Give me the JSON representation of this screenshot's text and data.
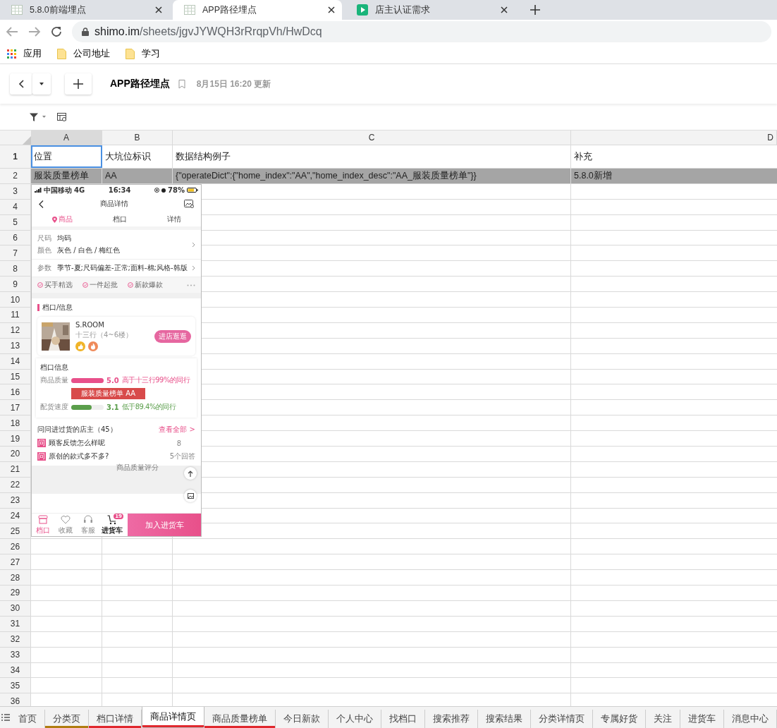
{
  "browser": {
    "tabs": [
      {
        "title": "5.8.0前端埋点",
        "selected": false,
        "kind": "sheet"
      },
      {
        "title": "APP路径埋点",
        "selected": true,
        "kind": "sheet"
      },
      {
        "title": "店主认证需求",
        "selected": false,
        "kind": "play"
      }
    ],
    "address": {
      "host": "shimo.im",
      "path": "/sheets/jgvJYWQH3rRrqpVh/HwDcq"
    },
    "bookmarks": [
      {
        "label": "应用",
        "kind": "apps"
      },
      {
        "label": "公司地址",
        "kind": "folder"
      },
      {
        "label": "学习",
        "kind": "folder"
      }
    ]
  },
  "document": {
    "title": "APP路径埋点",
    "updated": "8月15日 16:20 更新"
  },
  "sheet": {
    "columns": [
      {
        "label": "A",
        "selected": true
      },
      {
        "label": "B",
        "selected": false
      },
      {
        "label": "C",
        "selected": false
      },
      {
        "label": "D",
        "selected": false
      }
    ],
    "rows": [
      {
        "number": "1",
        "highlighted": false,
        "cells": [
          {
            "text": "位置",
            "active": true
          },
          {
            "text": "大坑位标识",
            "active": false
          },
          {
            "text": "数据结构例子",
            "active": false
          },
          {
            "text": "补充",
            "active": false
          }
        ]
      },
      {
        "number": "2",
        "highlighted": true,
        "cells": [
          {
            "text": "服装质量榜单",
            "active": false
          },
          {
            "text": "AA",
            "active": false
          },
          {
            "text": "{\"operateDict\":{\"home_index\":\"AA\",\"home_index_desc\":\"AA_服装质量榜单\"}}",
            "active": false
          },
          {
            "text": "5.8.0新增",
            "active": false
          }
        ]
      },
      {
        "number": "3",
        "highlighted": false
      },
      {
        "number": "4",
        "highlighted": false
      },
      {
        "number": "5",
        "highlighted": false
      },
      {
        "number": "6",
        "highlighted": false
      },
      {
        "number": "7",
        "highlighted": false
      },
      {
        "number": "8",
        "highlighted": false
      },
      {
        "number": "9",
        "highlighted": false
      },
      {
        "number": "10",
        "highlighted": false
      },
      {
        "number": "11",
        "highlighted": false
      },
      {
        "number": "12",
        "highlighted": false
      },
      {
        "number": "13",
        "highlighted": false
      },
      {
        "number": "14",
        "highlighted": false
      },
      {
        "number": "15",
        "highlighted": false
      },
      {
        "number": "16",
        "highlighted": false
      },
      {
        "number": "17",
        "highlighted": false
      },
      {
        "number": "18",
        "highlighted": false
      },
      {
        "number": "19",
        "highlighted": false
      },
      {
        "number": "20",
        "highlighted": false
      },
      {
        "number": "21",
        "highlighted": false
      },
      {
        "number": "22",
        "highlighted": false
      },
      {
        "number": "23",
        "highlighted": false
      },
      {
        "number": "24",
        "highlighted": false
      },
      {
        "number": "25",
        "highlighted": false
      },
      {
        "number": "26",
        "highlighted": false
      },
      {
        "number": "27",
        "highlighted": false
      },
      {
        "number": "28",
        "highlighted": false
      },
      {
        "number": "29",
        "highlighted": false
      },
      {
        "number": "30",
        "highlighted": false
      },
      {
        "number": "31",
        "highlighted": false
      },
      {
        "number": "32",
        "highlighted": false
      },
      {
        "number": "33",
        "highlighted": false
      },
      {
        "number": "34",
        "highlighted": false
      },
      {
        "number": "35",
        "highlighted": false
      },
      {
        "number": "36",
        "highlighted": false
      }
    ]
  },
  "phone_screenshot": {
    "status": {
      "carrier": "中国移动",
      "network": "4G",
      "time": "16:34",
      "battery": "78%"
    },
    "title": "商品详情",
    "tabs": [
      {
        "label": "商品",
        "selected": true
      },
      {
        "label": "档口",
        "selected": false
      },
      {
        "label": "详情",
        "selected": false
      }
    ],
    "attributes": [
      {
        "label": "尺码",
        "value": "均码"
      },
      {
        "label": "颜色",
        "value": "灰色 / 白色 / 梅红色"
      }
    ],
    "params": {
      "label": "参数",
      "value": "季节-夏;尺码偏差-正常;面料-棉;风格-韩版"
    },
    "badges": [
      "买手精选",
      "一件起批",
      "新款爆款"
    ],
    "section_title": "档口/信息",
    "store": {
      "name": "S.ROOM",
      "location": "十三行（4~6楼）",
      "button": "进店逛逛"
    },
    "stall_info": {
      "title": "档口信息",
      "metrics": [
        {
          "label": "商品质量",
          "level": 1.0,
          "score": "5.0",
          "comparison": "高于十三行99%的同行",
          "color": "#e8508a"
        },
        {
          "label": "配货速度",
          "level": 0.62,
          "score": "3.1",
          "comparison": "低于89.4%的同行",
          "color": "#5a9e4b"
        }
      ],
      "banner": "服装质量榜单 AA"
    },
    "questions": {
      "title": "问问进过货的店主（45）",
      "link": "查看全部 >",
      "items": [
        {
          "mark": "问",
          "text": "顾客反馈怎么样呢",
          "answers": "8"
        },
        {
          "mark": "问",
          "text": "原创的款式多不多?",
          "answers": "5个回答"
        }
      ]
    },
    "overlay_label": "商品质量评分",
    "bottom_bar": {
      "items": [
        {
          "label": "档口",
          "selected": true,
          "kind": "store"
        },
        {
          "label": "收藏",
          "selected": false,
          "kind": "heart"
        },
        {
          "label": "客服",
          "selected": false,
          "kind": "headset"
        },
        {
          "label": "进货车",
          "selected": false,
          "kind": "cart",
          "badge": "19"
        }
      ],
      "button": "加入进货车"
    }
  },
  "sheet_tabs": [
    {
      "label": "首页",
      "selected": false
    },
    {
      "label": "分类页",
      "selected": false,
      "color": "#b07d10"
    },
    {
      "label": "档口详情",
      "selected": false,
      "color": "#e0282e"
    },
    {
      "label": "商品详情页",
      "selected": true,
      "color": "#e0282e"
    },
    {
      "label": "商品质量榜单",
      "selected": false,
      "color": "#e0282e"
    },
    {
      "label": "今日新款",
      "selected": false
    },
    {
      "label": "个人中心",
      "selected": false
    },
    {
      "label": "找档口",
      "selected": false
    },
    {
      "label": "搜索推荐",
      "selected": false
    },
    {
      "label": "搜索结果",
      "selected": false
    },
    {
      "label": "分类详情页",
      "selected": false
    },
    {
      "label": "专属好货",
      "selected": false
    },
    {
      "label": "关注",
      "selected": false
    },
    {
      "label": "进货车",
      "selected": false
    },
    {
      "label": "消息中心",
      "selected": false
    }
  ]
}
